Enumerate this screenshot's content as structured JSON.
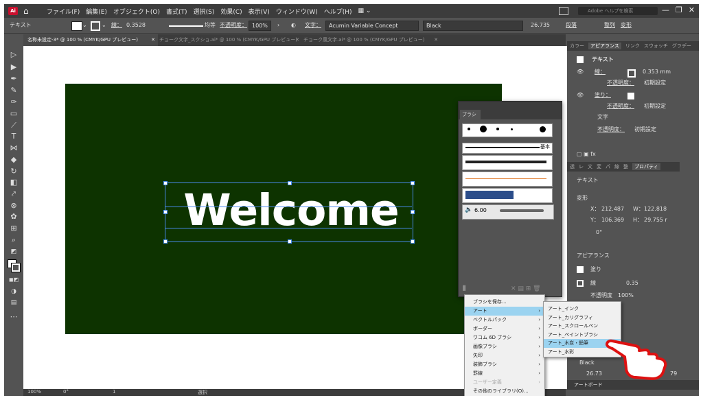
{
  "menubar": {
    "logo": "Ai",
    "menus": [
      "ファイル(F)",
      "編集(E)",
      "オブジェクト(O)",
      "書式(T)",
      "選択(S)",
      "効果(C)",
      "表示(V)",
      "ウィンドウ(W)",
      "ヘルプ(H)"
    ],
    "search_placeholder": "Adobe ヘルプを検索"
  },
  "control": {
    "label": "テキスト",
    "stroke_label": "線：",
    "stroke_value": "0.3528",
    "stroke_style": "均等",
    "opacity_label": "不透明度：",
    "opacity_value": "100%",
    "font_label": "文字：",
    "font_value": "Acumin Variable Concept",
    "style_value": "Black",
    "size_value": "26.735",
    "paragraph": "段落",
    "align": "整列",
    "transform": "変形"
  },
  "tabs": [
    "名称未設定-3* @ 100 % (CMYK/GPU プレビュー)",
    "チョーク文字_スクショ.ai* @ 100 % (CMYK/GPU プレビュー)",
    "チョーク風文字.ai* @ 100 % (CMYK/GPU プレビュー)"
  ],
  "canvas": {
    "text": "Welcome",
    "artboard_color": "#0d3300"
  },
  "status": {
    "zoom": "100%",
    "angle": "0°",
    "page": "1",
    "mode": "選択"
  },
  "appearance_panel": {
    "tabs": [
      "カラー",
      "アピアランス",
      "リンク",
      "スウォッチ",
      "グラデー"
    ],
    "title": "テキスト",
    "stroke_label": "線：",
    "stroke_value": "0.353 mm",
    "opacity_label": "不透明度：",
    "opacity_value": "初期設定",
    "fill_label": "塗り：",
    "char_label": "文字"
  },
  "properties_panel": {
    "tabs": [
      "透",
      "レ",
      "文",
      "変",
      "パ",
      "線",
      "整",
      "プロパティ"
    ],
    "section_text": "テキスト",
    "section_transform": "変形",
    "x_label": "X：",
    "x_value": "212.487",
    "w_label": "W：",
    "w_value": "122.818",
    "y_label": "Y：",
    "y_value": "106.369",
    "h_label": "H：",
    "h_value": "29.755 r",
    "angle_value": "0°",
    "section_appearance": "アピアランス",
    "fill_label": "塗り",
    "stroke_label": "線",
    "stroke_value": "0.35",
    "opacity_label": "不透明度",
    "opacity_value": "100%",
    "font_style": "Black",
    "size_value": "26.73",
    "line_value": "79",
    "artboard_tab": "アートボード"
  },
  "brush_panel": {
    "title": "ブラシ",
    "basic_label": "基本",
    "size_value": "6.00"
  },
  "brush_menu": {
    "items": [
      {
        "label": "ブラシを保存...",
        "arrow": false,
        "highlight": false,
        "disabled": false
      },
      {
        "label": "アート",
        "arrow": true,
        "highlight": true,
        "disabled": false
      },
      {
        "label": "ベクトルパック",
        "arrow": true,
        "highlight": false,
        "disabled": false
      },
      {
        "label": "ボーダー",
        "arrow": true,
        "highlight": false,
        "disabled": false
      },
      {
        "label": "ワコム 6D ブラシ",
        "arrow": true,
        "highlight": false,
        "disabled": false
      },
      {
        "label": "画像ブラシ",
        "arrow": true,
        "highlight": false,
        "disabled": false
      },
      {
        "label": "矢印",
        "arrow": true,
        "highlight": false,
        "disabled": false
      },
      {
        "label": "装飾ブラシ",
        "arrow": true,
        "highlight": false,
        "disabled": false
      },
      {
        "label": "罫線",
        "arrow": true,
        "highlight": false,
        "disabled": false
      },
      {
        "label": "ユーザー定義",
        "arrow": true,
        "highlight": false,
        "disabled": true
      },
      {
        "label": "その他のライブラリ(O)...",
        "arrow": false,
        "highlight": false,
        "disabled": false
      }
    ]
  },
  "art_submenu": {
    "items": [
      "アート_インク",
      "アート_カリグラフィ",
      "アート_スクロールペン",
      "アート_ペイントブラシ",
      "アート_木炭・鉛筆",
      "アート_水彩"
    ],
    "highlight_index": 4
  }
}
